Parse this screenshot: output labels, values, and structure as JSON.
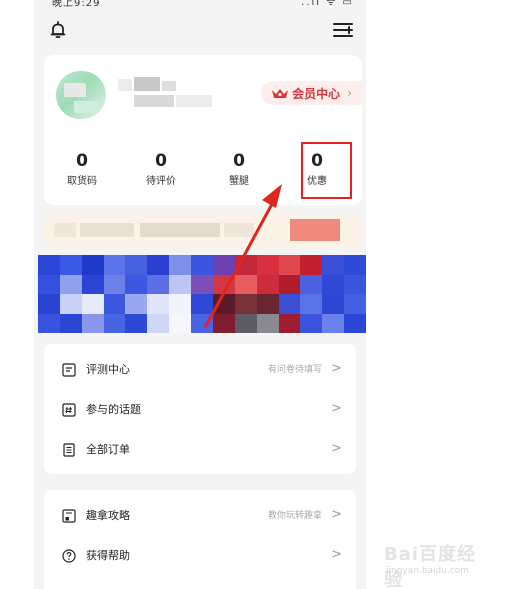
{
  "status_bar": {
    "time": "晚上9:29",
    "icons": "..ıl ᯤ ▭"
  },
  "user": {
    "vip_label": "会员中心",
    "vip_chevron": "›"
  },
  "stats": [
    {
      "value": "0",
      "label": "取货码"
    },
    {
      "value": "0",
      "label": "待评价"
    },
    {
      "value": "0",
      "label": "蟹腿"
    },
    {
      "value": "0",
      "label": "优惠"
    }
  ],
  "menu_group_1": [
    {
      "label": "评测中心",
      "hint": "有问卷待填写",
      "icon": "review-icon"
    },
    {
      "label": "参与的话题",
      "hint": "",
      "icon": "topic-icon"
    },
    {
      "label": "全部订单",
      "hint": "",
      "icon": "orders-icon"
    }
  ],
  "menu_group_2": [
    {
      "label": "趣拿攻略",
      "hint": "教你玩转趣拿",
      "icon": "guide-icon"
    },
    {
      "label": "获得帮助",
      "hint": "",
      "icon": "help-icon"
    }
  ],
  "chevron": ">",
  "watermark": {
    "logo": "Bai百度经验",
    "url": "jingyan.baidu.com"
  },
  "colors": {
    "accent_red": "#e0251e",
    "vip_red": "#d6393a",
    "page_bg": "#f4f4f4"
  }
}
